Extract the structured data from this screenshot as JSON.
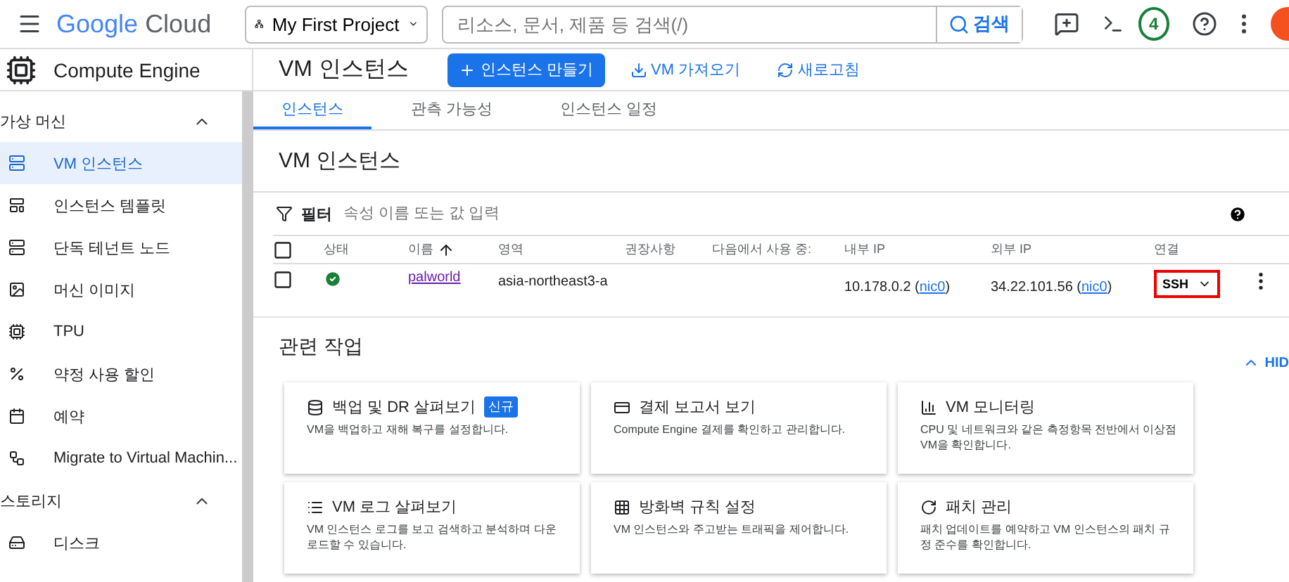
{
  "header": {
    "logo_google": "Google",
    "logo_cloud": "Cloud",
    "project": "My First Project",
    "search_placeholder": "리소스, 문서, 제품 등 검색(/)",
    "search_button": "검색",
    "notification_count": "4"
  },
  "product": "Compute Engine",
  "page_title": "VM 인스턴스",
  "actions": [
    {
      "label": "인스턴스 만들기",
      "kind": "primary"
    },
    {
      "label": "VM 가져오기",
      "kind": "link"
    },
    {
      "label": "새로고침",
      "kind": "link"
    }
  ],
  "sidebar": [
    {
      "title": "가상 머신",
      "expanded": true,
      "items": [
        {
          "label": "VM 인스턴스",
          "selected": true
        },
        {
          "label": "인스턴스 템플릿",
          "selected": false
        },
        {
          "label": "단독 테넌트 노드",
          "selected": false
        },
        {
          "label": "머신 이미지",
          "selected": false
        },
        {
          "label": "TPU",
          "selected": false
        },
        {
          "label": "약정 사용 할인",
          "selected": false
        },
        {
          "label": "예약",
          "selected": false
        },
        {
          "label": "Migrate to Virtual Machin...",
          "selected": false
        }
      ]
    },
    {
      "title": "스토리지",
      "expanded": true,
      "items": [
        {
          "label": "디스크",
          "selected": false
        }
      ]
    }
  ],
  "tabs": [
    {
      "label": "인스턴스",
      "selected": true
    },
    {
      "label": "관측 가능성",
      "selected": false
    },
    {
      "label": "인스턴스 일정",
      "selected": false
    }
  ],
  "list_title": "VM 인스턴스",
  "filter": {
    "label": "필터",
    "placeholder": "속성 이름 또는 값 입력"
  },
  "table": {
    "columns": [
      {
        "label": "상태",
        "sorted": false
      },
      {
        "label": "이름",
        "sorted": true
      },
      {
        "label": "영역",
        "sorted": false
      },
      {
        "label": "권장사항",
        "sorted": false
      },
      {
        "label": "다음에서 사용 중:",
        "sorted": false
      },
      {
        "label": "내부 IP",
        "sorted": false
      },
      {
        "label": "외부 IP",
        "sorted": false
      },
      {
        "label": "연결",
        "sorted": false
      }
    ],
    "all_checked": false,
    "rows": [
      {
        "checked": false,
        "running": true,
        "name": "palworld",
        "zone": "asia-northeast3-a",
        "internal_ip": {
          "text": "10.178.0.2 (",
          "link": "nic0",
          "after": ")"
        },
        "external_ip": {
          "text": "34.22.101.56 (",
          "link": "nic0",
          "after": ")"
        },
        "connect": "SSH",
        "highlighted": true
      }
    ]
  },
  "related": {
    "title": "관련 작업",
    "hide": "HID",
    "cards": [
      {
        "title": "백업 및 DR 살펴보기",
        "badge": "신규",
        "description": "VM을 백업하고 재해 복구를 설정합니다."
      },
      {
        "title": "결제 보고서 보기",
        "description": "Compute Engine 결제를 확인하고 관리합니다."
      },
      {
        "title": "VM 모니터링",
        "description": "CPU 및 네트워크와 같은 측정항목 전반에서 이상점 VM을 확인합니다."
      },
      {
        "title": "VM 로그 살펴보기",
        "description": "VM 인스턴스 로그를 보고 검색하고 분석하며 다운로드할 수 있습니다."
      },
      {
        "title": "방화벽 규칙 설정",
        "description": "VM 인스턴스와 주고받는 트래픽을 제어합니다."
      },
      {
        "title": "패치 관리",
        "description": "패치 업데이트를 예약하고 VM 인스턴스의 패치 규정 준수를 확인합니다."
      }
    ]
  }
}
